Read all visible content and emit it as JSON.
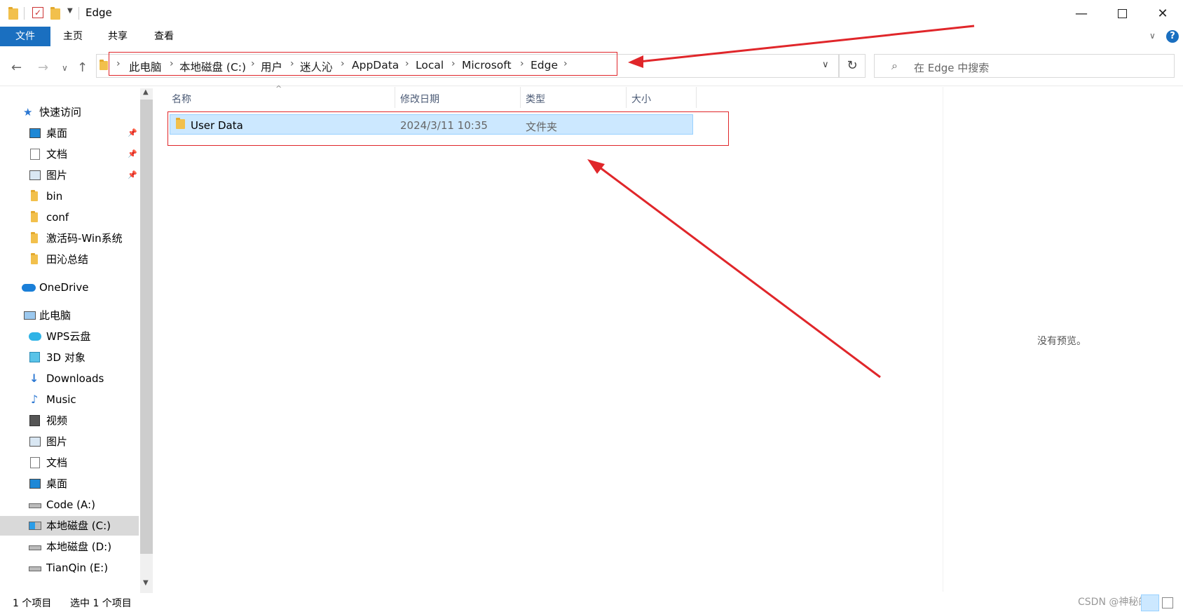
{
  "window": {
    "title": "Edge",
    "controls": [
      "minimize-icon",
      "maximize-icon",
      "close-icon"
    ]
  },
  "ribbon": {
    "tabs": [
      "文件",
      "主页",
      "共享",
      "查看"
    ],
    "help": "?"
  },
  "address": {
    "breadcrumbs": [
      "此电脑",
      "本地磁盘 (C:)",
      "用户",
      "迷人沁",
      "AppData",
      "Local",
      "Microsoft",
      "Edge"
    ],
    "search_placeholder": "在 Edge 中搜索"
  },
  "sidebar": {
    "quick_access": "快速访问",
    "quick_items": [
      {
        "label": "桌面",
        "icon": "desktop-icon",
        "pinned": true
      },
      {
        "label": "文档",
        "icon": "document-icon",
        "pinned": true
      },
      {
        "label": "图片",
        "icon": "pictures-icon",
        "pinned": true
      },
      {
        "label": "bin",
        "icon": "folder-icon"
      },
      {
        "label": "conf",
        "icon": "folder-icon"
      },
      {
        "label": "激活码-Win系统",
        "icon": "folder-icon"
      },
      {
        "label": "田沁总结",
        "icon": "folder-icon"
      }
    ],
    "onedrive": "OneDrive",
    "this_pc": "此电脑",
    "pc_items": [
      {
        "label": "WPS云盘",
        "icon": "cloud-icon"
      },
      {
        "label": "3D 对象",
        "icon": "3d-objects-icon"
      },
      {
        "label": "Downloads",
        "icon": "downloads-icon"
      },
      {
        "label": "Music",
        "icon": "music-icon"
      },
      {
        "label": "视频",
        "icon": "video-icon"
      },
      {
        "label": "图片",
        "icon": "pictures-icon"
      },
      {
        "label": "文档",
        "icon": "document-icon"
      },
      {
        "label": "桌面",
        "icon": "desktop-icon"
      },
      {
        "label": "Code (A:)",
        "icon": "drive-icon"
      },
      {
        "label": "本地磁盘 (C:)",
        "icon": "windows-drive-icon",
        "selected": true
      },
      {
        "label": "本地磁盘 (D:)",
        "icon": "drive-icon"
      },
      {
        "label": "TianQin (E:)",
        "icon": "drive-icon"
      }
    ]
  },
  "file_list": {
    "columns": [
      "名称",
      "修改日期",
      "类型",
      "大小"
    ],
    "rows": [
      {
        "name": "User Data",
        "modified": "2024/3/11 10:35",
        "type": "文件夹",
        "size": ""
      }
    ]
  },
  "preview": {
    "text": "没有预览。"
  },
  "status": {
    "item_count": "1 个项目",
    "selected_count": "选中 1 个项目",
    "watermark": "CSDN @神秘的店"
  },
  "colors": {
    "accent": "#1a6fc0",
    "selection": "#cce8ff",
    "annotation": "#e0262a"
  }
}
